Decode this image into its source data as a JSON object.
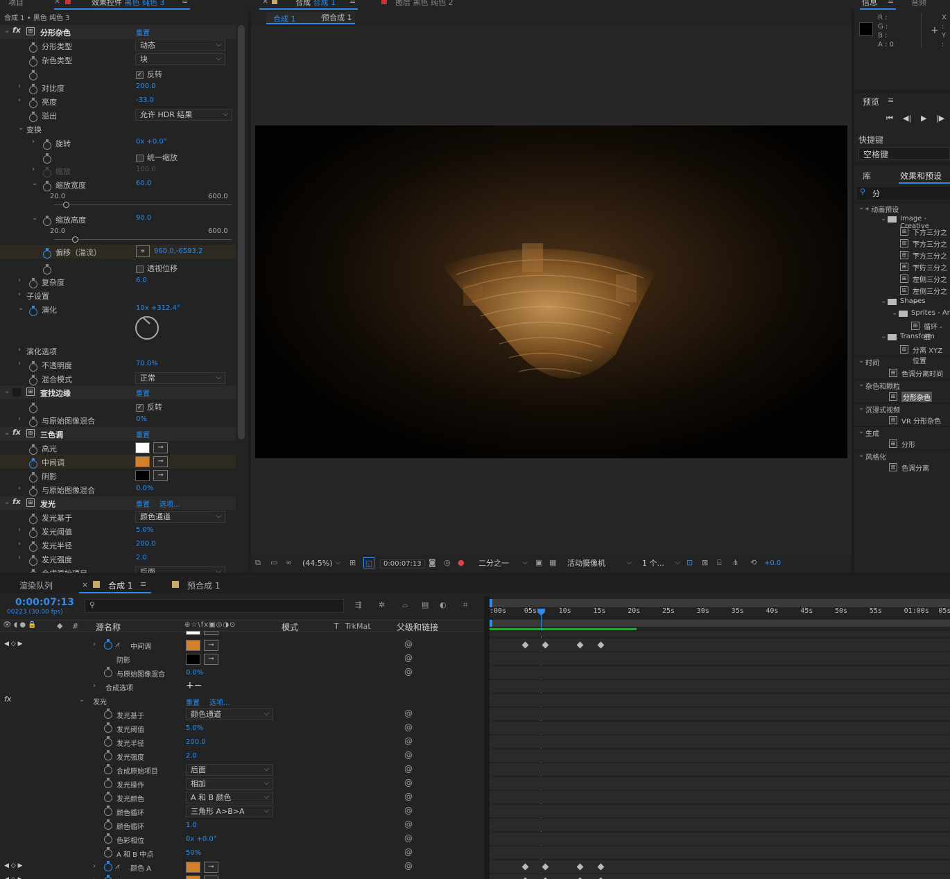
{
  "top_tabs": {
    "project": "项目",
    "effects_tab": "效果控件",
    "effects_layer": "黑色 纯色 3",
    "comp_tab": "合成",
    "comp_name": "合成 1",
    "layer_tab": "图层",
    "layer_name": "黑色 纯色 2",
    "info": "信息",
    "audio": "音频"
  },
  "effects_panel": {
    "breadcrumb": "合成 1 • 黑色 纯色 3",
    "reset": "重置",
    "options": "选项...",
    "fractal": {
      "name": "分形杂色",
      "fractal_type_label": "分形类型",
      "fractal_type": "动态",
      "noise_type_label": "杂色类型",
      "noise_type": "块",
      "invert": "反转",
      "contrast_label": "对比度",
      "contrast": "200.0",
      "brightness_label": "亮度",
      "brightness": "-33.0",
      "overflow_label": "溢出",
      "overflow": "允许 HDR 结果",
      "transform": "变换",
      "rotation_label": "旋转",
      "rotation": "0x +0.0°",
      "uniform_scale": "统一缩放",
      "scale_label": "缩放",
      "scale": "100.0",
      "scale_width_label": "缩放宽度",
      "scale_width": "60.0",
      "slider_min": "20.0",
      "slider_max": "600.0",
      "scale_height_label": "缩放高度",
      "scale_height": "90.0",
      "offset_label": "偏移（湍流）",
      "offset": "960.0,-6593.2",
      "perspective": "透视位移",
      "complexity_label": "复杂度",
      "complexity": "6.0",
      "sub_settings": "子设置",
      "evolution_label": "演化",
      "evolution": "10x +312.4°",
      "evolution_options": "演化选项",
      "opacity_label": "不透明度",
      "opacity": "70.0%",
      "blend_label": "混合模式",
      "blend": "正常"
    },
    "find_edges": {
      "name": "查找边缘",
      "invert": "反转",
      "blend_label": "与原始图像混合",
      "blend": "0%"
    },
    "tritone": {
      "name": "三色调",
      "highlights": "高光",
      "midtones": "中间调",
      "shadows": "阴影",
      "blend_label": "与原始图像混合",
      "blend": "0.0%"
    },
    "glow": {
      "name": "发光",
      "based_on_label": "发光基于",
      "based_on": "颜色通道",
      "threshold_label": "发光阈值",
      "threshold": "5.0%",
      "radius_label": "发光半径",
      "radius": "200.0",
      "intensity_label": "发光强度",
      "intensity": "2.0",
      "composite_label": "合成原始项目",
      "composite": "后面"
    }
  },
  "viewer": {
    "tab_active": "合成 1",
    "tab_pre": "预合成 1",
    "zoom": "(44.5%)",
    "timecode": "0:00:07:13",
    "resolution": "二分之一",
    "camera": "活动摄像机",
    "views": "1 个...",
    "exposure": "+0.0"
  },
  "info_panel": {
    "r": "R :",
    "g": "G :",
    "b": "B :",
    "a": "A : 0",
    "x": "X :",
    "y": "Y :"
  },
  "preview": {
    "title": "预览"
  },
  "shortcut": {
    "label": "快捷键",
    "value": "空格键"
  },
  "effects_presets": {
    "tab_lib": "库",
    "tab_active": "效果和预设",
    "search": "分",
    "tree": [
      {
        "t": "* 动画预设",
        "lv": 0,
        "kind": "open"
      },
      {
        "t": "Image - Creative",
        "lv": 1,
        "kind": "folder"
      },
      {
        "t": "下方三分之一",
        "lv": 2,
        "kind": "item"
      },
      {
        "t": "下方三分之一",
        "lv": 2,
        "kind": "item"
      },
      {
        "t": "下方三分之一(",
        "lv": 2,
        "kind": "item"
      },
      {
        "t": "下方三分之一(",
        "lv": 2,
        "kind": "item"
      },
      {
        "t": "左侧三分之一",
        "lv": 2,
        "kind": "item"
      },
      {
        "t": "左侧三分之一",
        "lv": 2,
        "kind": "item"
      },
      {
        "t": "Shapes",
        "lv": 1,
        "kind": "folder"
      },
      {
        "t": "Sprites - Ar",
        "lv": 2,
        "kind": "folder"
      },
      {
        "t": "循环 - 细",
        "lv": 3,
        "kind": "item"
      },
      {
        "t": "Transform",
        "lv": 1,
        "kind": "folder"
      },
      {
        "t": "分离 XYZ 位置",
        "lv": 2,
        "kind": "item"
      },
      {
        "t": "时间",
        "lv": 0,
        "kind": "open"
      },
      {
        "t": "色调分离时间",
        "lv": 1,
        "kind": "item"
      },
      {
        "t": "杂色和颗粒",
        "lv": 0,
        "kind": "open"
      },
      {
        "t": "分形杂色",
        "lv": 1,
        "kind": "item",
        "sel": true
      },
      {
        "t": "沉浸式视频",
        "lv": 0,
        "kind": "open"
      },
      {
        "t": "VR 分形杂色",
        "lv": 1,
        "kind": "item"
      },
      {
        "t": "生成",
        "lv": 0,
        "kind": "open"
      },
      {
        "t": "分形",
        "lv": 1,
        "kind": "item"
      },
      {
        "t": "风格化",
        "lv": 0,
        "kind": "open"
      },
      {
        "t": "色调分离",
        "lv": 1,
        "kind": "item"
      }
    ]
  },
  "timeline": {
    "render_queue": "渲染队列",
    "comp_tab": "合成 1",
    "pre_tab": "预合成 1",
    "timecode": "0:00:07:13",
    "frame_info": "00223 (30.00 fps)",
    "search_placeholder": "",
    "col_source": "源名称",
    "col_mode": "模式",
    "col_t": "T",
    "col_trkmat": "TrkMat",
    "col_parent": "父级和链接",
    "ruler": [
      ":00s",
      "05s",
      "10s",
      "15s",
      "20s",
      "25s",
      "30s",
      "35s",
      "40s",
      "45s",
      "50s",
      "55s",
      "01:00s",
      "05s"
    ],
    "rows": {
      "midtones": "中间调",
      "shadows": "阴影",
      "blend_label": "与原始图像混合",
      "blend": "0.0%",
      "composite_options": "合成选项",
      "glow": "发光",
      "reset": "重置",
      "options": "选项...",
      "based_on_label": "发光基于",
      "based_on": "颜色通道",
      "threshold_label": "发光阈值",
      "threshold": "5.0%",
      "radius_label": "发光半径",
      "radius": "200.0",
      "intensity_label": "发光强度",
      "intensity": "2.0",
      "composite_label": "合成原始项目",
      "composite": "后面",
      "operation_label": "发光操作",
      "operation": "相加",
      "colors_label": "发光颜色",
      "colors": "A 和 B 颜色",
      "loop_label": "颜色循环",
      "loop": "三角形 A>B>A",
      "cycles_label": "颜色循环",
      "cycles": "1.0",
      "phase_label": "色彩相位",
      "phase": "0x +0.0°",
      "midpoint_label": "A 和 B 中点",
      "midpoint": "50%",
      "color_a": "颜色 A"
    }
  },
  "colors": {
    "accent": "#2d8ceb",
    "midtone_orange": "#d47f2c",
    "highlight_white": "#ffffff",
    "shadow_black": "#000000"
  }
}
